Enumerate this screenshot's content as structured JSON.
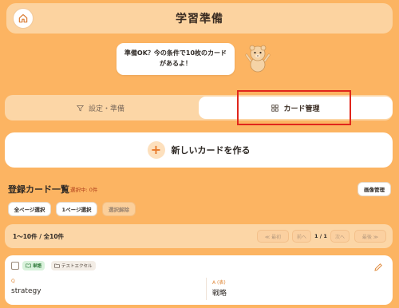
{
  "header": {
    "title": "学習準備",
    "home_icon": "home-icon"
  },
  "bubble": {
    "line1": "準備OK？今の条件で10枚のカード",
    "line2": "があるよ！"
  },
  "tabs": {
    "setup_label": "設定・準備",
    "setup_icon": "funnel-icon",
    "cards_label": "カード管理",
    "cards_icon": "grid-icon"
  },
  "new_card": {
    "label": "新しいカードを作る",
    "icon": "plus-icon"
  },
  "list": {
    "title": "登録カード一覧",
    "selected_count": "選択中: 0件",
    "image_button": "画像管理",
    "select_all": "全ページ選択",
    "select_page": "1ページ選択",
    "clear_selection": "選択解除"
  },
  "pager": {
    "range": "1〜10件 / 全10件",
    "first": "≪ 最初",
    "prev": "前へ",
    "page": "1 / 1",
    "next": "次へ",
    "last": "最後 ≫"
  },
  "card": {
    "tag_type": "単語",
    "tag_folder": "テストエクセル",
    "q_label": "Q",
    "question": "strategy",
    "a_label": "A (表)",
    "answer": "戦略"
  },
  "colors": {
    "background": "#fcb462",
    "panel": "#fcd6a6",
    "accent": "#e8792a",
    "highlight_box": "#e0261c"
  }
}
